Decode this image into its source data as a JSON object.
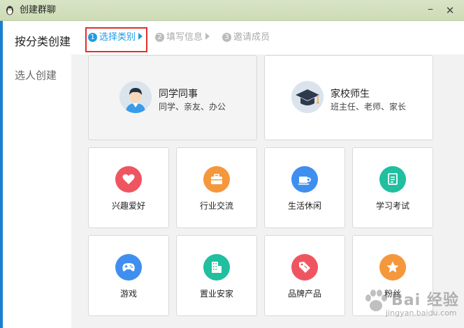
{
  "window": {
    "title": "创建群聊"
  },
  "sidebar": {
    "items": [
      {
        "label": "按分类创建"
      },
      {
        "label": "选人创建"
      }
    ]
  },
  "steps": [
    {
      "num": "1",
      "label": "选择类别"
    },
    {
      "num": "2",
      "label": "填写信息"
    },
    {
      "num": "3",
      "label": "邀请成员"
    }
  ],
  "big_categories": [
    {
      "title": "同学同事",
      "subtitle": "同学、亲友、办公",
      "icon": "student-avatar-icon"
    },
    {
      "title": "家校师生",
      "subtitle": "班主任、老师、家长",
      "icon": "graduation-cap-icon"
    }
  ],
  "categories": [
    {
      "label": "兴趣爱好",
      "icon": "heart-icon",
      "color": "#ef5560"
    },
    {
      "label": "行业交流",
      "icon": "briefcase-icon",
      "color": "#f5973b"
    },
    {
      "label": "生活休闲",
      "icon": "coffee-cup-icon",
      "color": "#3e8ff0"
    },
    {
      "label": "学习考试",
      "icon": "document-icon",
      "color": "#1fbf9f"
    },
    {
      "label": "游戏",
      "icon": "gamepad-icon",
      "color": "#3e8ff0"
    },
    {
      "label": "置业安家",
      "icon": "building-icon",
      "color": "#1fbf9f"
    },
    {
      "label": "品牌产品",
      "icon": "price-tag-icon",
      "color": "#ef5560"
    },
    {
      "label": "粉丝",
      "icon": "star-icon",
      "color": "#f5973b"
    }
  ],
  "watermark": {
    "text": "Bai 经验",
    "url": "jingyan.baidu.com"
  }
}
